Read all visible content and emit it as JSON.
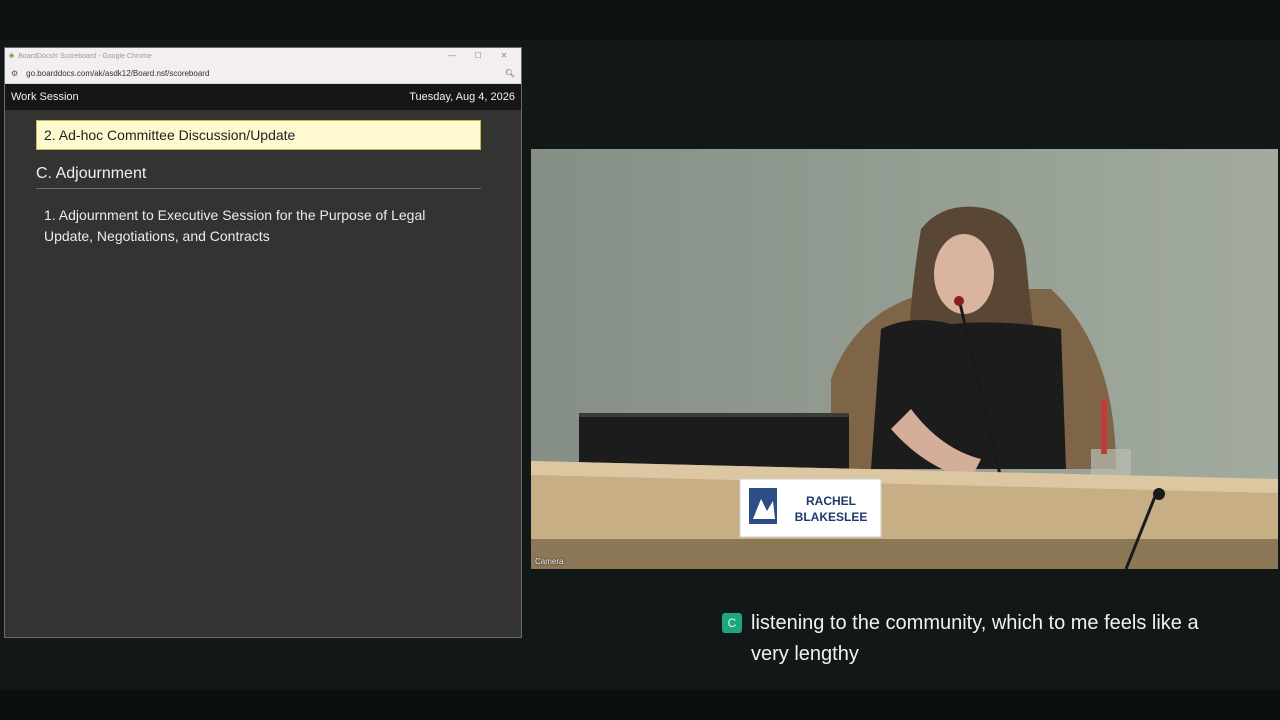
{
  "browser": {
    "title": "BoardDocs® Scoreboard - Google Chrome",
    "url": "go.boarddocs.com/ak/asdk12/Board.nsf/scoreboard",
    "icons": {
      "favicon": "tree-icon",
      "site": "site-settings-icon",
      "zoom": "zoom-icon"
    }
  },
  "scoreboard": {
    "session_type": "Work Session",
    "date": "Tuesday, Aug 4, 2026",
    "current_item": "2. Ad-hoc Committee Discussion/Update",
    "section_heading": "C. Adjournment",
    "items": [
      {
        "text": "1. Adjournment to Executive Session for the Purpose of Legal Update, Negotiations, and Contracts"
      }
    ]
  },
  "camera": {
    "label": "Camera",
    "nameplate_line1": "RACHEL",
    "nameplate_line2": "BLAKESLEE"
  },
  "caption": {
    "badge": "C",
    "text": "listening to the community, which to me feels like a very lengthy"
  },
  "colors": {
    "highlight_bg": "#fff9cf",
    "caption_badge": "#1fa67e",
    "panel_bg": "#333332"
  }
}
